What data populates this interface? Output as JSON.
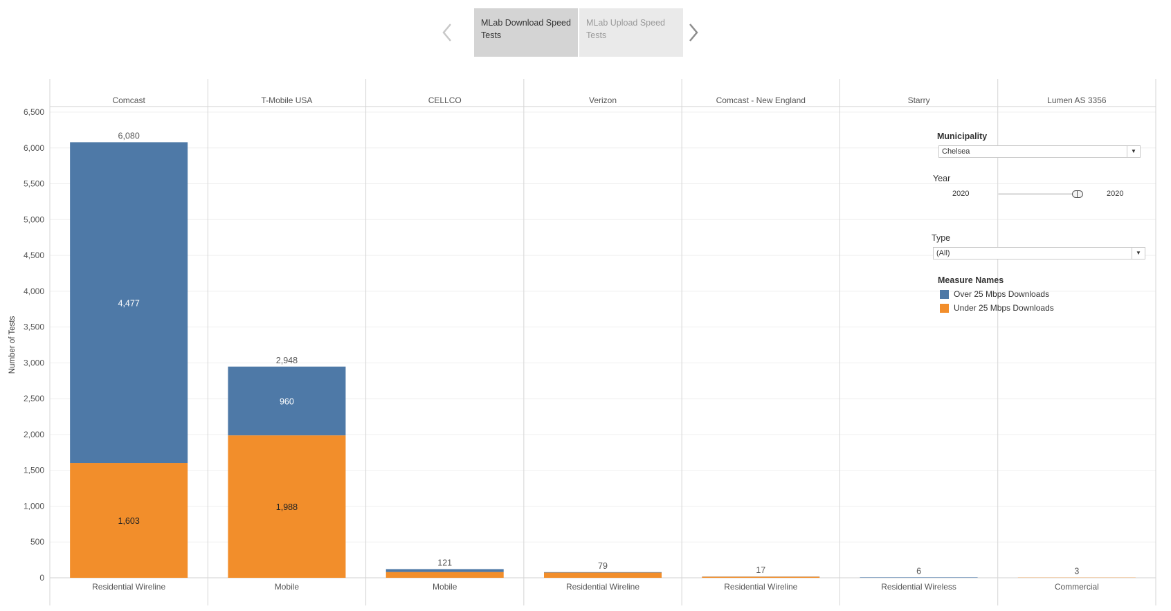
{
  "story": {
    "tabs": [
      {
        "label": "MLab Download Speed Tests",
        "active": true
      },
      {
        "label": "MLab Upload Speed Tests",
        "active": false
      }
    ]
  },
  "filters": {
    "municipality": {
      "title": "Municipality",
      "value": "Chelsea"
    },
    "year": {
      "title": "Year",
      "min": "2020",
      "max": "2020",
      "value": 2020
    },
    "type": {
      "title": "Type",
      "value": "(All)"
    }
  },
  "legend": {
    "title": "Measure Names",
    "items": [
      {
        "label": "Over 25 Mbps Downloads",
        "color": "#4e79a7"
      },
      {
        "label": "Under 25 Mbps Downloads",
        "color": "#f28e2b"
      }
    ]
  },
  "chart_data": {
    "type": "bar",
    "stacked": true,
    "ylabel": "Number of Tests",
    "ylim": [
      0,
      6500
    ],
    "yticks": [
      0,
      500,
      1000,
      1500,
      2000,
      2500,
      3000,
      3500,
      4000,
      4500,
      5000,
      5500,
      6000,
      6500
    ],
    "ytick_labels": [
      "0",
      "500",
      "1,000",
      "1,500",
      "2,000",
      "2,500",
      "3,000",
      "3,500",
      "4,000",
      "4,500",
      "5,000",
      "5,500",
      "6,000",
      "6,500"
    ],
    "grid": true,
    "columns": [
      "Comcast",
      "T-Mobile USA",
      "CELLCO",
      "Verizon",
      "Comcast - New England",
      "Starry",
      "Lumen AS 3356"
    ],
    "categories": [
      "Residential Wireline",
      "Mobile",
      "Mobile",
      "Residential Wireline",
      "Residential Wireline",
      "Residential Wireless",
      "Commercial"
    ],
    "series": [
      {
        "name": "Over 25 Mbps Downloads",
        "values": [
          4477,
          960,
          40,
          6,
          2,
          6,
          0
        ],
        "labels": [
          "4,477",
          "960",
          "",
          "",
          "",
          "",
          ""
        ]
      },
      {
        "name": "Under 25 Mbps Downloads",
        "values": [
          1603,
          1988,
          81,
          73,
          15,
          0,
          3
        ],
        "labels": [
          "1,603",
          "1,988",
          "",
          "",
          "",
          "",
          ""
        ]
      }
    ],
    "totals": [
      6080,
      2948,
      121,
      79,
      17,
      6,
      3
    ],
    "total_labels": [
      "6,080",
      "2,948",
      "121",
      "79",
      "17",
      "6",
      "3"
    ],
    "colors": [
      "#4e79a7",
      "#f28e2b"
    ]
  }
}
